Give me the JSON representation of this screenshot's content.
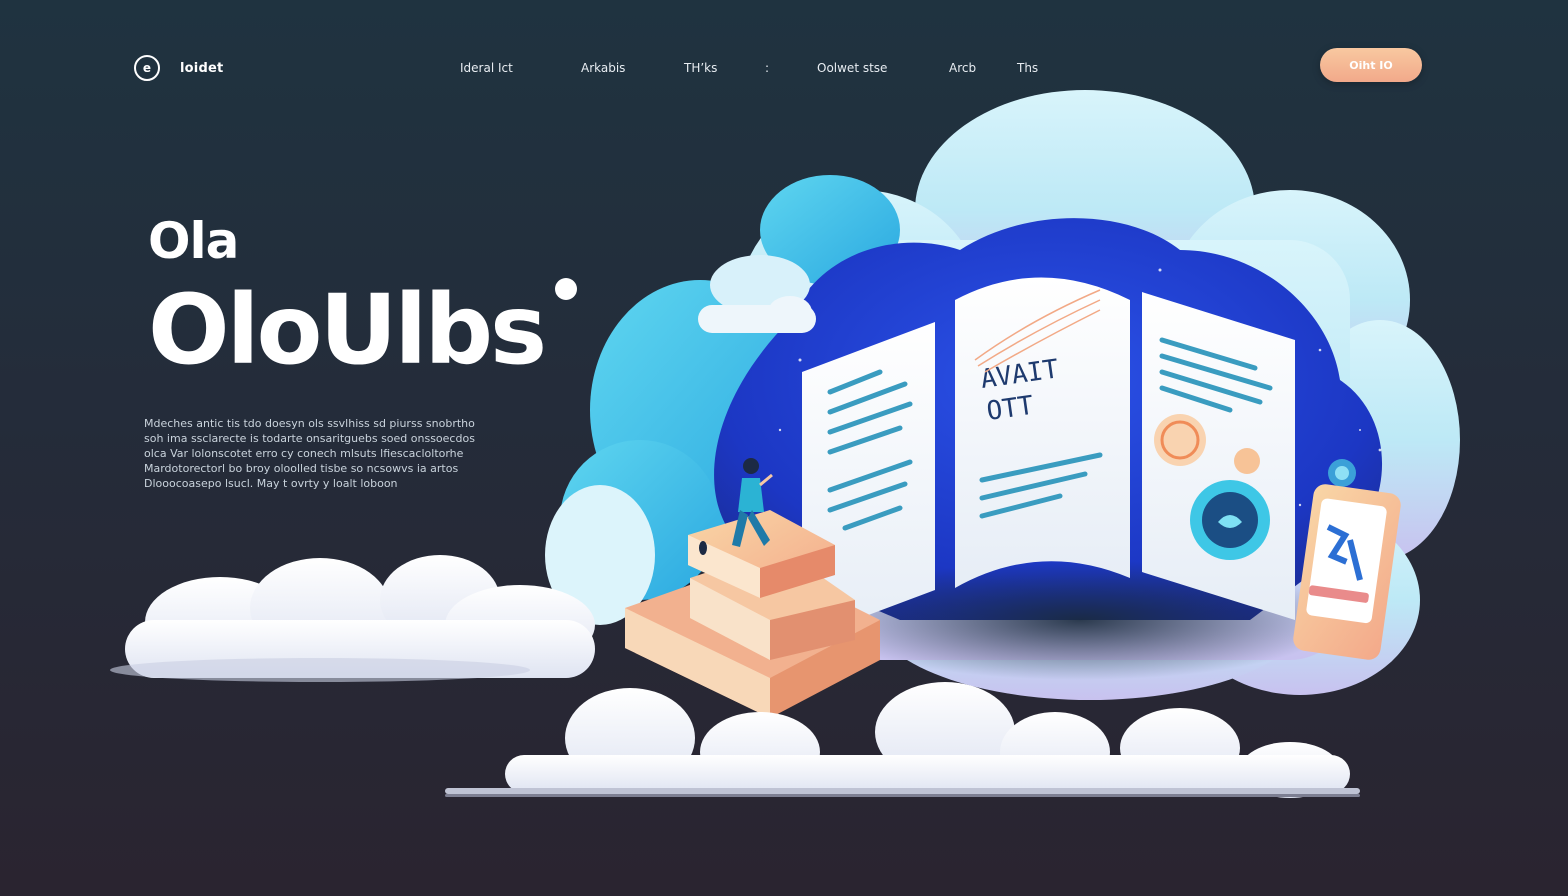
{
  "header": {
    "logo_glyph": "e",
    "brand": "loidet",
    "nav": [
      "Ideral Ict",
      "Arkabis",
      "TH’ks",
      ":",
      "Oolwet stse",
      "Arcb",
      "Ths"
    ],
    "cta": "Oiht IO"
  },
  "hero": {
    "eyebrow": "Ola",
    "headline": "OloUlbs",
    "description": [
      "Mdeches antic tis tdo doesyn ols ssvlhiss sd piurss snobrtho",
      "soh ima ssclarecte is todarte onsaritguebs soed onssoecdos",
      "olca Var lolonscotet erro cy conech mlsuts lfiescacloltorhe",
      "Mardotorectorl bo broy oloolled tisbe so ncsowvs ia artos",
      "Dlooocoasepo lsucl. May t ovrty y loalt loboon"
    ]
  },
  "illustration": {
    "book_heading": [
      "AVAIT",
      "OTT"
    ]
  },
  "colors": {
    "background_top": "#1f3340",
    "background_bottom": "#2a2430",
    "cta": "#f4b090",
    "cloud_cyan": "#3fc7e8",
    "night_blue": "#1e3fd0",
    "accent_peach": "#f6b98f",
    "page_lines": "#3a9cc0"
  }
}
